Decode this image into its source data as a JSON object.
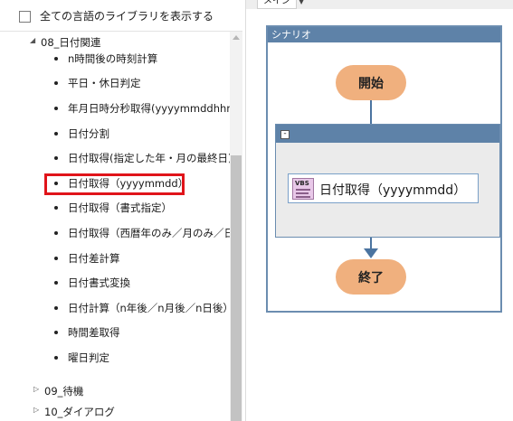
{
  "library": {
    "show_all_languages": "全ての言語のライブラリを表示する",
    "category_open": "08_日付関連",
    "items": [
      "n時間後の時刻計算",
      "平日・休日判定",
      "年月日時分秒取得(yyyymmddhhmmss)",
      "日付分割",
      "日付取得(指定した年・月の最終日)",
      "日付取得（yyyymmdd）",
      "日付取得（書式指定）",
      "日付取得（西暦年のみ／月のみ／日のみ）",
      "日付差計算",
      "日付書式変換",
      "日付計算（n年後／n月後／n日後）",
      "時間差取得",
      "曜日判定"
    ],
    "category_09": "09_待機",
    "category_10": "10_ダイアログ"
  },
  "editor": {
    "tab_label": "メイン",
    "scenario_title": "シナリオ",
    "start_label": "開始",
    "end_label": "終了",
    "collapse_symbol": "-",
    "action_label": "日付取得（yyyymmdd）",
    "vbs_badge": "VBS"
  },
  "colors": {
    "header_blue": "#5e82a8",
    "oval_orange": "#f0b07e",
    "highlight_red": "#e0141a",
    "vbs_icon": "#e8c8e8"
  }
}
